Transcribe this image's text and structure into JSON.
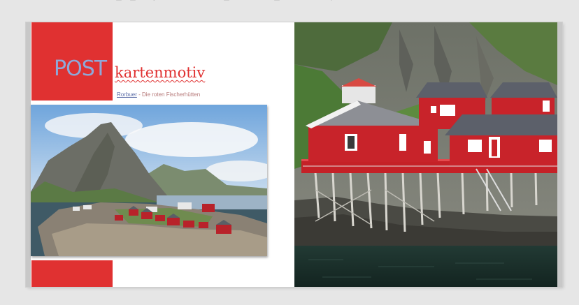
{
  "poster": {
    "title_part1": "POST",
    "title_part2": "kartenmotiv",
    "subtitle_link": "Rorbuer",
    "subtitle_rest": " - Die roten Fischerhütten"
  },
  "colors": {
    "accent_red": "#e03131",
    "title_blue": "#8fa8d8",
    "link_blue": "#5e6fa8"
  },
  "toolbar_icons": [
    "page-icon",
    "page-icon",
    "pointer-icon",
    "undo-icon",
    "redo-icon",
    "page-icon",
    "page-icon",
    "dropdown-icon"
  ]
}
